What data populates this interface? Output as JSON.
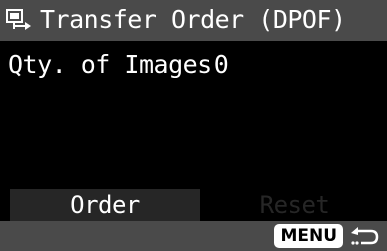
{
  "title": {
    "icon": "print-transfer-icon",
    "text": "Transfer Order (DPOF)"
  },
  "quantity": {
    "label": "Qty. of Images",
    "value": "0"
  },
  "buttons": {
    "order_label": "Order",
    "reset_label": "Reset"
  },
  "footer": {
    "menu_label": "MENU",
    "return_icon": "return-arrow-icon"
  },
  "colors": {
    "title_bar": "#4a4a4a",
    "background": "#000000",
    "selected_button": "#262626",
    "text": "#ffffff",
    "disabled_text": "#262626"
  }
}
